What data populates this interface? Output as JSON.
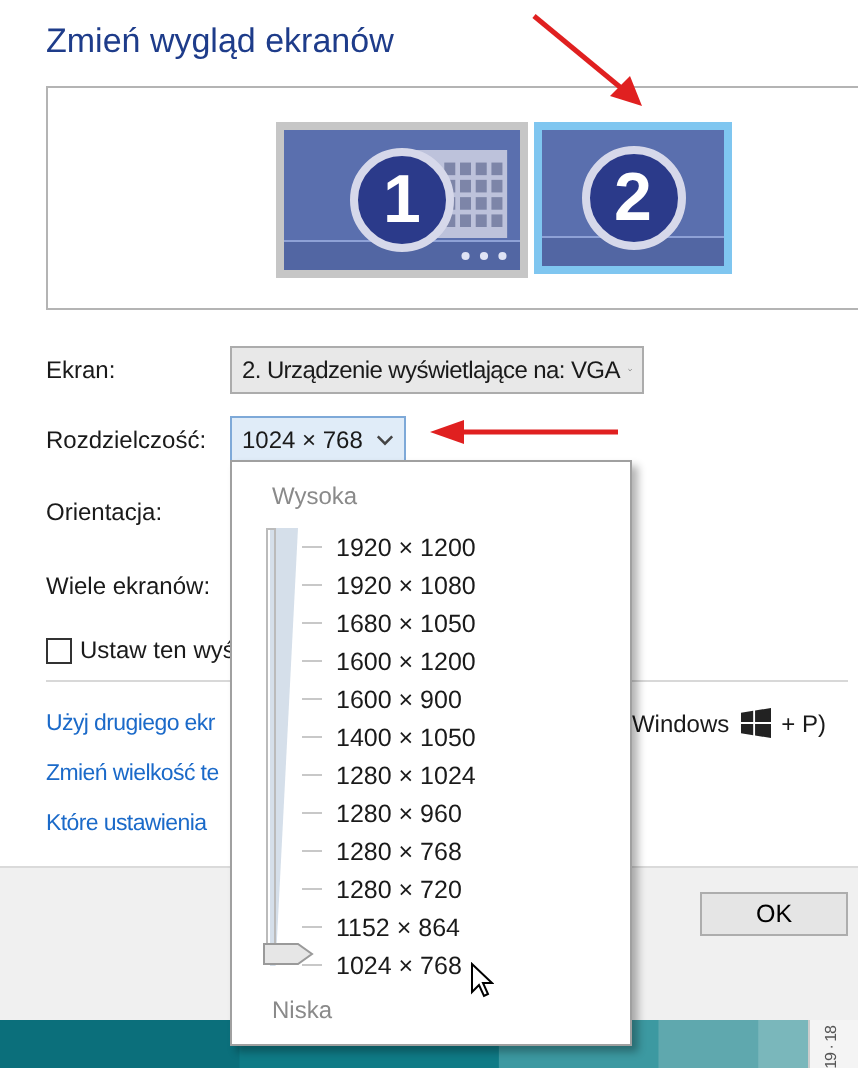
{
  "title": "Zmień wygląd ekranów",
  "monitors": [
    {
      "label": "1",
      "selected": false
    },
    {
      "label": "2",
      "selected": true
    }
  ],
  "fields": [
    {
      "kind": "select",
      "label": "Ekran:",
      "value": "2. Urządzenie wyświetlające na: VGA",
      "expanded": false
    },
    {
      "kind": "select",
      "label": "Rozdzielczość:",
      "value": "1024 × 768",
      "expanded": true
    },
    {
      "kind": "label",
      "label": "Orientacja:"
    },
    {
      "kind": "label",
      "label": "Wiele ekranów:"
    }
  ],
  "checkbox": {
    "label": "Ustaw ten wyś",
    "checked": false
  },
  "links": [
    "Użyj drugiego ekr",
    "Zmień wielkość te",
    "Które ustawienia"
  ],
  "shortcut_hint": {
    "before": "Windows",
    "after": "+ P)"
  },
  "resolution_popup": {
    "high_label": "Wysoka",
    "low_label": "Niska",
    "level": 0,
    "options": [
      "1920 × 1200",
      "1920 × 1080",
      "1680 × 1050",
      "1600 × 1200",
      "1600 × 900",
      "1400 × 1050",
      "1280 × 1024",
      "1280 × 960",
      "1280 × 768",
      "1280 × 720",
      "1152 × 864",
      "1024 × 768"
    ]
  },
  "buttons": [
    "OK"
  ],
  "taskbar_clip": "19 · 18"
}
